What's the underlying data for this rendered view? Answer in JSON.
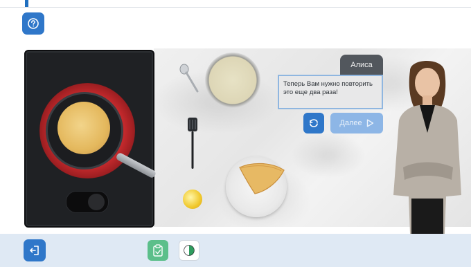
{
  "assistant": {
    "name": "Алиса",
    "message": "Теперь Вам нужно повторить это еще два раза!"
  },
  "controls": {
    "next_label": "Далее"
  },
  "icons": {
    "help": "question-circle-icon",
    "repeat": "repeat-icon",
    "next_arrow": "play-outline-icon",
    "exit": "exit-door-icon",
    "task": "clipboard-icon",
    "contrast": "contrast-icon"
  },
  "colors": {
    "primary_button": "#2f77c9",
    "next_button": "#8db6e6",
    "bottom_bar": "#dfe9f4",
    "task_button": "#5cbf8a",
    "burner": "#c3292c",
    "speech_border": "#8fb6e0"
  }
}
